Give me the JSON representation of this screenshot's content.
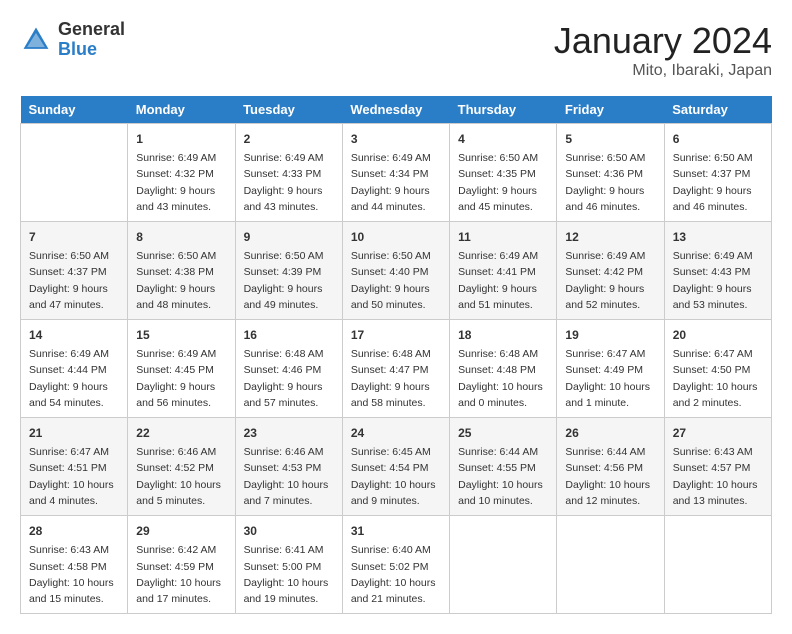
{
  "header": {
    "logo_general": "General",
    "logo_blue": "Blue",
    "month_title": "January 2024",
    "location": "Mito, Ibaraki, Japan"
  },
  "columns": [
    "Sunday",
    "Monday",
    "Tuesday",
    "Wednesday",
    "Thursday",
    "Friday",
    "Saturday"
  ],
  "weeks": [
    [
      {
        "day": "",
        "info": ""
      },
      {
        "day": "1",
        "info": "Sunrise: 6:49 AM\nSunset: 4:32 PM\nDaylight: 9 hours\nand 43 minutes."
      },
      {
        "day": "2",
        "info": "Sunrise: 6:49 AM\nSunset: 4:33 PM\nDaylight: 9 hours\nand 43 minutes."
      },
      {
        "day": "3",
        "info": "Sunrise: 6:49 AM\nSunset: 4:34 PM\nDaylight: 9 hours\nand 44 minutes."
      },
      {
        "day": "4",
        "info": "Sunrise: 6:50 AM\nSunset: 4:35 PM\nDaylight: 9 hours\nand 45 minutes."
      },
      {
        "day": "5",
        "info": "Sunrise: 6:50 AM\nSunset: 4:36 PM\nDaylight: 9 hours\nand 46 minutes."
      },
      {
        "day": "6",
        "info": "Sunrise: 6:50 AM\nSunset: 4:37 PM\nDaylight: 9 hours\nand 46 minutes."
      }
    ],
    [
      {
        "day": "7",
        "info": "Sunrise: 6:50 AM\nSunset: 4:37 PM\nDaylight: 9 hours\nand 47 minutes."
      },
      {
        "day": "8",
        "info": "Sunrise: 6:50 AM\nSunset: 4:38 PM\nDaylight: 9 hours\nand 48 minutes."
      },
      {
        "day": "9",
        "info": "Sunrise: 6:50 AM\nSunset: 4:39 PM\nDaylight: 9 hours\nand 49 minutes."
      },
      {
        "day": "10",
        "info": "Sunrise: 6:50 AM\nSunset: 4:40 PM\nDaylight: 9 hours\nand 50 minutes."
      },
      {
        "day": "11",
        "info": "Sunrise: 6:49 AM\nSunset: 4:41 PM\nDaylight: 9 hours\nand 51 minutes."
      },
      {
        "day": "12",
        "info": "Sunrise: 6:49 AM\nSunset: 4:42 PM\nDaylight: 9 hours\nand 52 minutes."
      },
      {
        "day": "13",
        "info": "Sunrise: 6:49 AM\nSunset: 4:43 PM\nDaylight: 9 hours\nand 53 minutes."
      }
    ],
    [
      {
        "day": "14",
        "info": "Sunrise: 6:49 AM\nSunset: 4:44 PM\nDaylight: 9 hours\nand 54 minutes."
      },
      {
        "day": "15",
        "info": "Sunrise: 6:49 AM\nSunset: 4:45 PM\nDaylight: 9 hours\nand 56 minutes."
      },
      {
        "day": "16",
        "info": "Sunrise: 6:48 AM\nSunset: 4:46 PM\nDaylight: 9 hours\nand 57 minutes."
      },
      {
        "day": "17",
        "info": "Sunrise: 6:48 AM\nSunset: 4:47 PM\nDaylight: 9 hours\nand 58 minutes."
      },
      {
        "day": "18",
        "info": "Sunrise: 6:48 AM\nSunset: 4:48 PM\nDaylight: 10 hours\nand 0 minutes."
      },
      {
        "day": "19",
        "info": "Sunrise: 6:47 AM\nSunset: 4:49 PM\nDaylight: 10 hours\nand 1 minute."
      },
      {
        "day": "20",
        "info": "Sunrise: 6:47 AM\nSunset: 4:50 PM\nDaylight: 10 hours\nand 2 minutes."
      }
    ],
    [
      {
        "day": "21",
        "info": "Sunrise: 6:47 AM\nSunset: 4:51 PM\nDaylight: 10 hours\nand 4 minutes."
      },
      {
        "day": "22",
        "info": "Sunrise: 6:46 AM\nSunset: 4:52 PM\nDaylight: 10 hours\nand 5 minutes."
      },
      {
        "day": "23",
        "info": "Sunrise: 6:46 AM\nSunset: 4:53 PM\nDaylight: 10 hours\nand 7 minutes."
      },
      {
        "day": "24",
        "info": "Sunrise: 6:45 AM\nSunset: 4:54 PM\nDaylight: 10 hours\nand 9 minutes."
      },
      {
        "day": "25",
        "info": "Sunrise: 6:44 AM\nSunset: 4:55 PM\nDaylight: 10 hours\nand 10 minutes."
      },
      {
        "day": "26",
        "info": "Sunrise: 6:44 AM\nSunset: 4:56 PM\nDaylight: 10 hours\nand 12 minutes."
      },
      {
        "day": "27",
        "info": "Sunrise: 6:43 AM\nSunset: 4:57 PM\nDaylight: 10 hours\nand 13 minutes."
      }
    ],
    [
      {
        "day": "28",
        "info": "Sunrise: 6:43 AM\nSunset: 4:58 PM\nDaylight: 10 hours\nand 15 minutes."
      },
      {
        "day": "29",
        "info": "Sunrise: 6:42 AM\nSunset: 4:59 PM\nDaylight: 10 hours\nand 17 minutes."
      },
      {
        "day": "30",
        "info": "Sunrise: 6:41 AM\nSunset: 5:00 PM\nDaylight: 10 hours\nand 19 minutes."
      },
      {
        "day": "31",
        "info": "Sunrise: 6:40 AM\nSunset: 5:02 PM\nDaylight: 10 hours\nand 21 minutes."
      },
      {
        "day": "",
        "info": ""
      },
      {
        "day": "",
        "info": ""
      },
      {
        "day": "",
        "info": ""
      }
    ]
  ]
}
